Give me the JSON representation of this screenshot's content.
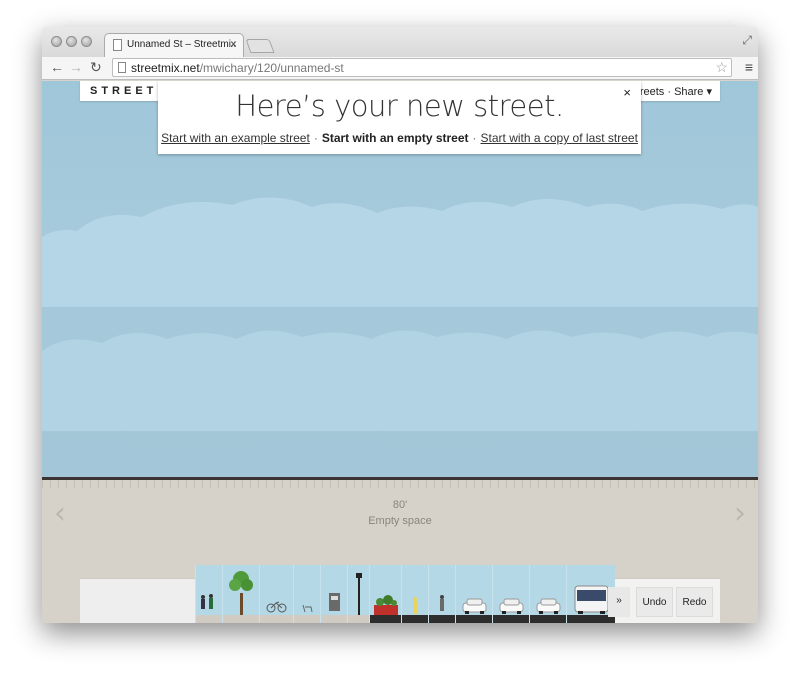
{
  "browser": {
    "tab_title": "Unnamed St – Streetmix",
    "tab_close": "×",
    "url_host": "streetmix.net",
    "url_path": "/mwichary/120/unnamed-st",
    "back": "←",
    "forward": "→",
    "reload": "↻",
    "star": "☆",
    "menu": "≡",
    "fullscreen": "⤢"
  },
  "header": {
    "logo": "STREETM",
    "menu_links": "treets · Share ▾"
  },
  "welcome": {
    "title": "Here’s your new street.",
    "close": "×",
    "option_example": "Start with an example street",
    "option_empty": "Start with an empty street",
    "option_copy": "Start with a copy of last street",
    "separator": "·"
  },
  "street": {
    "width": "80'",
    "segment_name": "Empty space",
    "left_arrow": "‹",
    "right_arrow": "›"
  },
  "palette": {
    "items": [
      "sidewalk-people",
      "sidewalk-tree",
      "sidewalk-bike-rack",
      "sidewalk-bench",
      "sidewalk-newspaper-box",
      "sidewalk-lamp",
      "parklet",
      "bike-lane",
      "pedestrian-refuge",
      "drive-lane",
      "turn-lane",
      "parking-lane",
      "bus-lane"
    ],
    "more_label": "»",
    "undo_label": "Undo",
    "redo_label": "Redo"
  },
  "colors": {
    "sky": "#a3c7d9",
    "ground": "#d6d2ca",
    "ground_line": "#3a3533",
    "palette_bg": "#b4d8e6"
  }
}
